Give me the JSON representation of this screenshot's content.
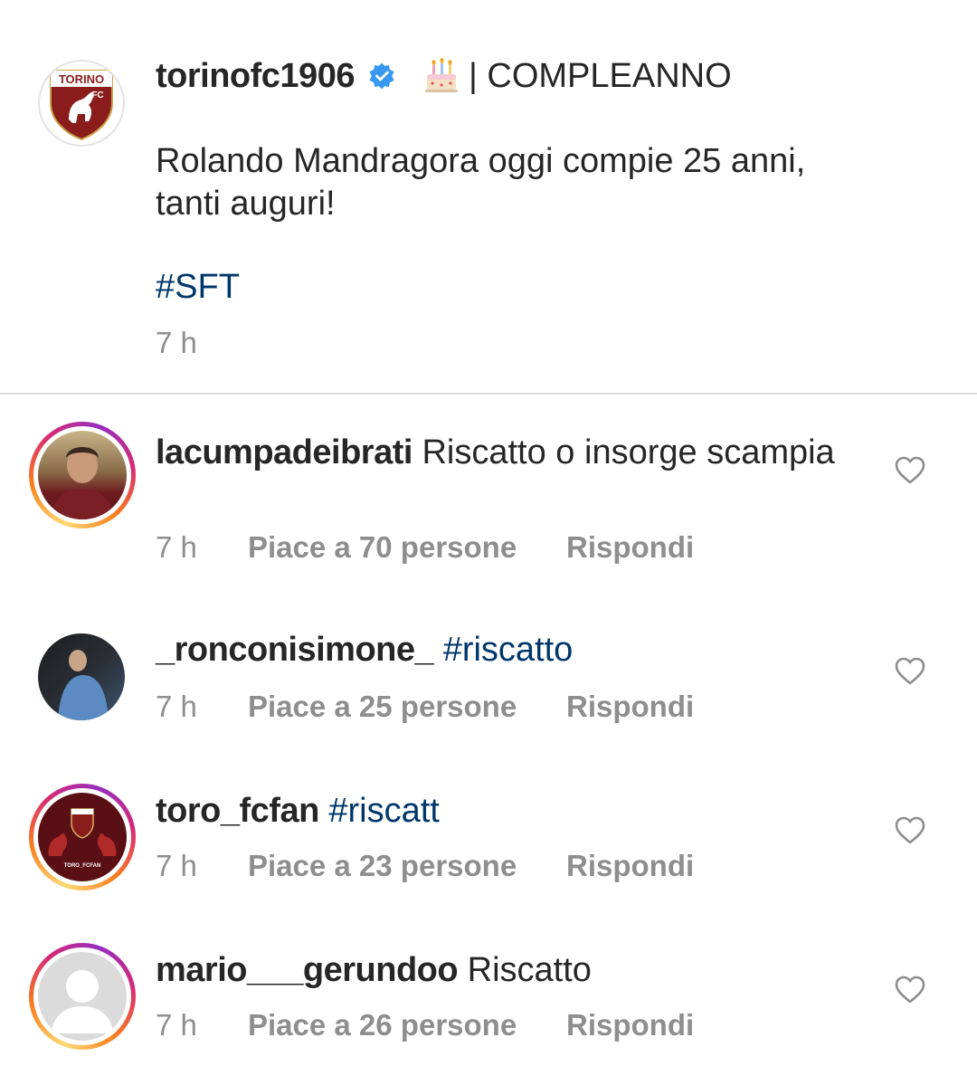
{
  "post": {
    "username": "torinofc1906",
    "cake_icon": "birthday-cake-icon",
    "title": "| COMPLEANNO",
    "caption_line1": "Rolando Mandragora oggi compie 25 anni,",
    "caption_line2": "tanti auguri!",
    "hashtag": "#SFT",
    "time": "7 h",
    "logo_text": "TORINO",
    "logo_fc": "FC"
  },
  "comments": [
    {
      "username": "lacumpadeibrati",
      "text": "Riscatto o insorge scampia",
      "time": "7 h",
      "likes": "Piace a 70 persone",
      "reply": "Rispondi"
    },
    {
      "username": "_ronconisimone_",
      "text": "#riscatto",
      "time": "7 h",
      "likes": "Piace a 25 persone",
      "reply": "Rispondi"
    },
    {
      "username": "toro_fcfan",
      "text": "#riscatt",
      "time": "7 h",
      "likes": "Piace a 23 persone",
      "reply": "Rispondi",
      "avatar_label": "TORO_FCFAN"
    },
    {
      "username": "mario___gerundoo",
      "text": "Riscatto",
      "time": "7 h",
      "likes": "Piace a 26 persone",
      "reply": "Rispondi"
    }
  ],
  "colors": {
    "text": "#262626",
    "secondary": "#8e8e8e",
    "link": "#00376b",
    "verified": "#3897f0",
    "torino_maroon": "#8a1c1c"
  }
}
